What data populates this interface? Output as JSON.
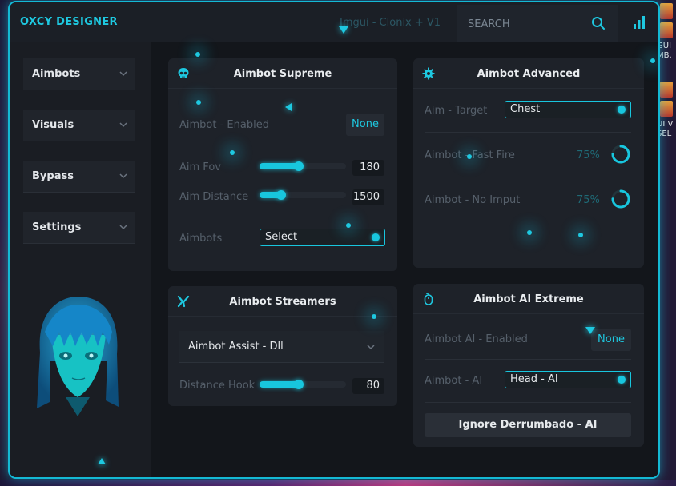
{
  "app": {
    "title": "OXCY DESIGNER",
    "subtitle": "Imgui - Clonix + V1",
    "accent": "#1ec8e0"
  },
  "search": {
    "placeholder": "SEARCH"
  },
  "desktop": {
    "right_labels": [
      "GUI MB.",
      "UI V SEL"
    ]
  },
  "sidebar": {
    "items": [
      {
        "label": "Aimbots"
      },
      {
        "label": "Visuals"
      },
      {
        "label": "Bypass"
      },
      {
        "label": "Settings"
      }
    ]
  },
  "aimbot_supreme": {
    "title": "Aimbot Supreme",
    "enabled_label": "Aimbot - Enabled",
    "enabled_value": "None",
    "fov_label": "Aim Fov",
    "fov_value": "180",
    "fov_fraction": 0.45,
    "distance_label": "Aim Distance",
    "distance_value": "1500",
    "distance_fraction": 0.25,
    "aimbots_label": "Aimbots",
    "aimbots_value": "Select"
  },
  "aimbot_advanced": {
    "title": "Aimbot Advanced",
    "target_label": "Aim  -  Target",
    "target_value": "Chest",
    "fast_fire_label": "Aimbot - Fast Fire",
    "fast_fire_value": "75%",
    "fast_fire_fraction": 0.75,
    "no_imput_label": "Aimbot - No Imput",
    "no_imput_value": "75%",
    "no_imput_fraction": 0.75
  },
  "aimbot_streamers": {
    "title": "Aimbot Streamers",
    "assist_label": "Aimbot Assist  -  Dll",
    "hook_label": "Distance Hook",
    "hook_value": "80",
    "hook_fraction": 0.45
  },
  "aimbot_ai": {
    "title": "Aimbot AI Extreme",
    "enabled_label": "Aimbot AI - Enabled",
    "enabled_value": "None",
    "ai_label": "Aimbot  -  AI",
    "ai_value": "Head  -  AI",
    "button_label": "Ignore Derrumbado  -  AI"
  }
}
